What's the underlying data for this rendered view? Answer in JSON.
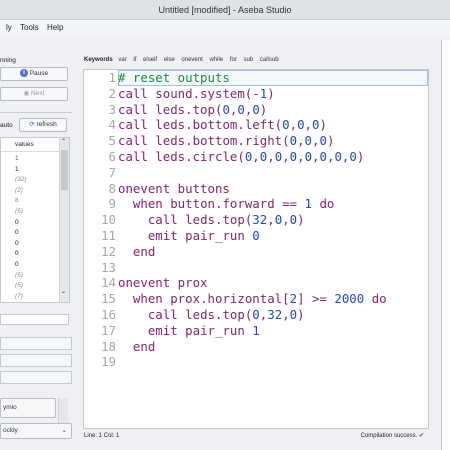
{
  "window": {
    "title": "Untitled [modified] - Aseba Studio"
  },
  "menu": {
    "items": [
      "ly",
      "Tools",
      "Help"
    ]
  },
  "execution": {
    "status": "nning",
    "pause_label": "Pause",
    "next_label": "Next"
  },
  "variables": {
    "auto_label": "auto",
    "refresh_label": "refresh",
    "column_header": "values",
    "values": [
      "1",
      "1",
      "(32)",
      "(2)",
      "8",
      "(5)",
      "0",
      "0",
      "0",
      "0",
      "0",
      "(5)",
      "(5)",
      "(7)"
    ]
  },
  "left_bottom": {
    "item1": "ymio",
    "item2": "ockly"
  },
  "editor": {
    "keywords_title": "Keywords",
    "keywords": [
      "var",
      "if",
      "elseif",
      "else",
      "onevent",
      "while",
      "for",
      "sub",
      "callsub"
    ],
    "line_numbers": [
      "1",
      "2",
      "3",
      "4",
      "5",
      "6",
      "7",
      "8",
      "9",
      "10",
      "11",
      "12",
      "13",
      "14",
      "15",
      "16",
      "17",
      "18",
      "19"
    ],
    "lines": [
      "# reset outputs",
      "call sound.system(-1)",
      "call leds.top(0,0,0)",
      "call leds.bottom.left(0,0,0)",
      "call leds.bottom.right(0,0,0)",
      "call leds.circle(0,0,0,0,0,0,0,0)",
      "",
      "onevent buttons",
      "  when button.forward == 1 do",
      "    call leds.top(32,0,0)",
      "    emit pair_run 0",
      "  end",
      "",
      "onevent prox",
      "  when prox.horizontal[2] >= 2000 do",
      "    call leds.top(0,32,0)",
      "    emit pair_run 1",
      "  end",
      ""
    ]
  },
  "status": {
    "position": "Line: 1 Col: 1",
    "compilation": "Compilation success."
  },
  "colors": {
    "comment": "#1b8a3a",
    "keyword": "#8a1f7a",
    "number": "#2048c8",
    "success_check": "#2e9d2e"
  }
}
